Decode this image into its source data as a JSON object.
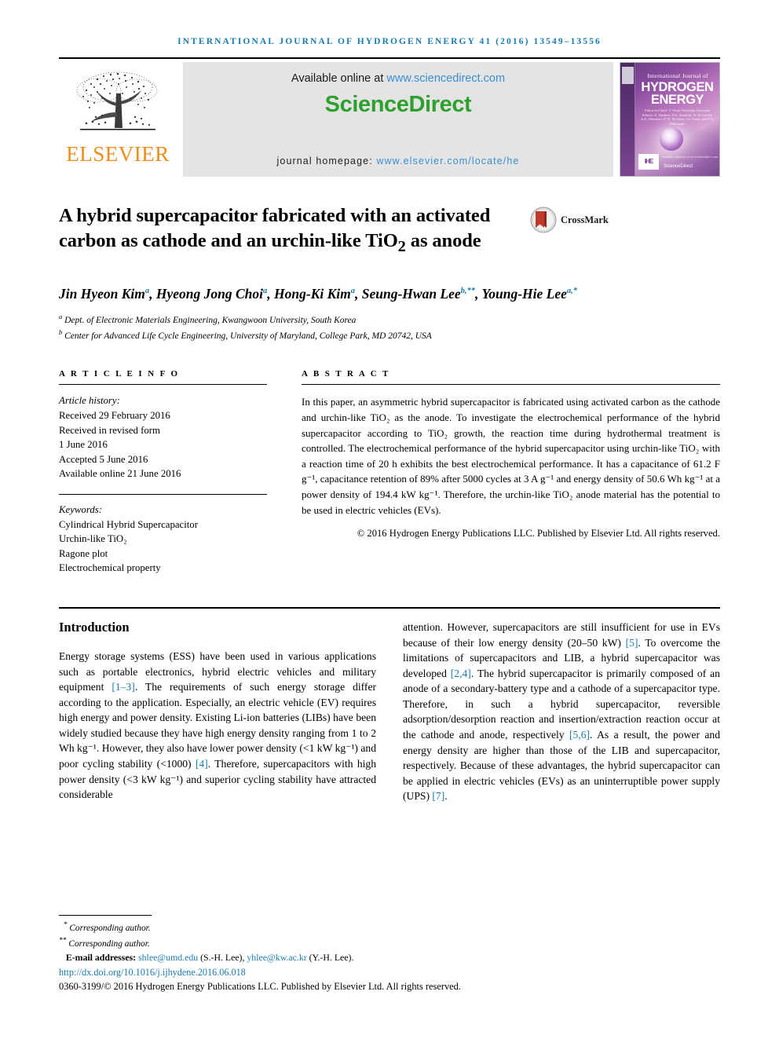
{
  "running_head": "International Journal of Hydrogen Energy 41 (2016) 13549–13556",
  "header": {
    "publisher": "ELSEVIER",
    "available_prefix": "Available online at ",
    "available_url": "www.sciencedirect.com",
    "sciencedirect_logo": "ScienceDirect",
    "homepage_prefix": "journal homepage: ",
    "homepage_url": "www.elsevier.com/locate/he",
    "cover": {
      "small_title": "International Journal of",
      "big_title_line1": "HYDROGEN",
      "big_title_line2": "ENERGY",
      "editors": "Editor-in-Chief:  T. Nejat Veziroğlu\nAssociate Editors:  A. Hashmi, D.S. Stanford, N. de Garcia, A.E. Abrashev, D.W. Da Rosa, Ga. Fazal, and F.A. Nebrasgilo",
      "badge": "IHE",
      "sd_mark": "ScienceDirect",
      "sd_mark_top": "Available online at www.sciencedirect.com"
    }
  },
  "title": "A hybrid supercapacitor fabricated with an activated carbon as cathode and an urchin-like TiO₂ as anode",
  "crossmark_label": "CrossMark",
  "authors": [
    {
      "name": "Jin Hyeon Kim",
      "marks": "a",
      "sep": ", "
    },
    {
      "name": "Hyeong Jong Choi",
      "marks": "a",
      "sep": ", "
    },
    {
      "name": "Hong-Ki Kim",
      "marks": "a",
      "sep": ", "
    },
    {
      "name": "Seung-Hwan Lee",
      "marks": "b,**",
      "sep": ", "
    },
    {
      "name": "Young-Hie Lee",
      "marks": "a,*",
      "sep": ""
    }
  ],
  "affiliations": [
    {
      "mark": "a",
      "text": "Dept. of Electronic Materials Engineering, Kwangwoon University, South Korea"
    },
    {
      "mark": "b",
      "text": "Center for Advanced Life Cycle Engineering, University of Maryland, College Park, MD 20742, USA"
    }
  ],
  "article_info": {
    "label": "A R T I C L E   I N F O",
    "history_head": "Article history:",
    "history": [
      "Received 29 February 2016",
      "Received in revised form",
      "1 June 2016",
      "Accepted 5 June 2016",
      "Available online 21 June 2016"
    ],
    "keywords_head": "Keywords:",
    "keywords": [
      "Cylindrical Hybrid Supercapacitor",
      "Urchin-like TiO₂",
      "Ragone plot",
      "Electrochemical property"
    ]
  },
  "abstract": {
    "label": "A B S T R A C T",
    "text": "In this paper, an asymmetric hybrid supercapacitor is fabricated using activated carbon as the cathode and urchin-like TiO₂ as the anode. To investigate the electrochemical performance of the hybrid supercapacitor according to TiO₂ growth, the reaction time during hydrothermal treatment is controlled. The electrochemical performance of the hybrid supercapacitor using urchin-like TiO₂ with a reaction time of 20 h exhibits the best electrochemical performance. It has a capacitance of 61.2 F g⁻¹, capacitance retention of 89% after 5000 cycles at 3 A g⁻¹ and energy density of 50.6 Wh kg⁻¹ at a power density of 194.4 kW kg⁻¹. Therefore, the urchin-like TiO₂ anode material has the potential to be used in electric vehicles (EVs).",
    "copyright": "© 2016 Hydrogen Energy Publications LLC. Published by Elsevier Ltd. All rights reserved."
  },
  "body": {
    "section_heading": "Introduction",
    "left_paragraph_parts": [
      {
        "t": "Energy storage systems (ESS) have been used in various applications such as portable electronics, hybrid electric vehicles and military equipment ",
        "ref": false
      },
      {
        "t": "[1–3]",
        "ref": true
      },
      {
        "t": ". The requirements of such energy storage differ according to the application. Especially, an electric vehicle (EV) requires high energy and power density. Existing Li-ion batteries (LIBs) have been widely studied because they have high energy density ranging from 1 to 2 Wh kg⁻¹. However, they also have lower power density (<1 kW kg⁻¹) and poor cycling stability (<1000) ",
        "ref": false
      },
      {
        "t": "[4]",
        "ref": true
      },
      {
        "t": ". Therefore, supercapacitors with high power density (<3 kW kg⁻¹) and superior cycling stability have attracted considerable",
        "ref": false
      }
    ],
    "right_paragraph_parts": [
      {
        "t": "attention. However, supercapacitors are still insufficient for use in EVs because of their low energy density (20–50 kW) ",
        "ref": false
      },
      {
        "t": "[5]",
        "ref": true
      },
      {
        "t": ". To overcome the limitations of supercapacitors and LIB, a hybrid supercapacitor was developed ",
        "ref": false
      },
      {
        "t": "[2,4]",
        "ref": true
      },
      {
        "t": ". The hybrid supercapacitor is primarily composed of an anode of a secondary-battery type and a cathode of a supercapacitor type. Therefore, in such a hybrid supercapacitor, reversible adsorption/desorption reaction and insertion/extraction reaction occur at the cathode and anode, respectively ",
        "ref": false
      },
      {
        "t": "[5,6]",
        "ref": true
      },
      {
        "t": ". As a result, the power and energy density are higher than those of the LIB and supercapacitor, respectively. Because of these advantages, the hybrid supercapacitor can be applied in electric vehicles (EVs) as an uninterruptible power supply (UPS) ",
        "ref": false
      },
      {
        "t": "[7]",
        "ref": true
      },
      {
        "t": ".",
        "ref": false
      }
    ]
  },
  "footnotes": {
    "corresponding_1_mark": "*",
    "corresponding_1": "Corresponding author.",
    "corresponding_2_mark": "**",
    "corresponding_2": "Corresponding author.",
    "email_label": "E-mail addresses:",
    "email_1": "shlee@umd.edu",
    "email_1_owner": "(S.-H. Lee)",
    "email_2": "yhlee@kw.ac.kr",
    "email_2_owner": "(Y.-H. Lee)",
    "doi": "http://dx.doi.org/10.1016/j.ijhydene.2016.06.018",
    "issn_line": "0360-3199/© 2016 Hydrogen Energy Publications LLC. Published by Elsevier Ltd. All rights reserved."
  },
  "colors": {
    "link_blue": "#1a7bb0",
    "elsevier_orange": "#F08C1A",
    "sciencedirect_green": "#2EA02E"
  }
}
